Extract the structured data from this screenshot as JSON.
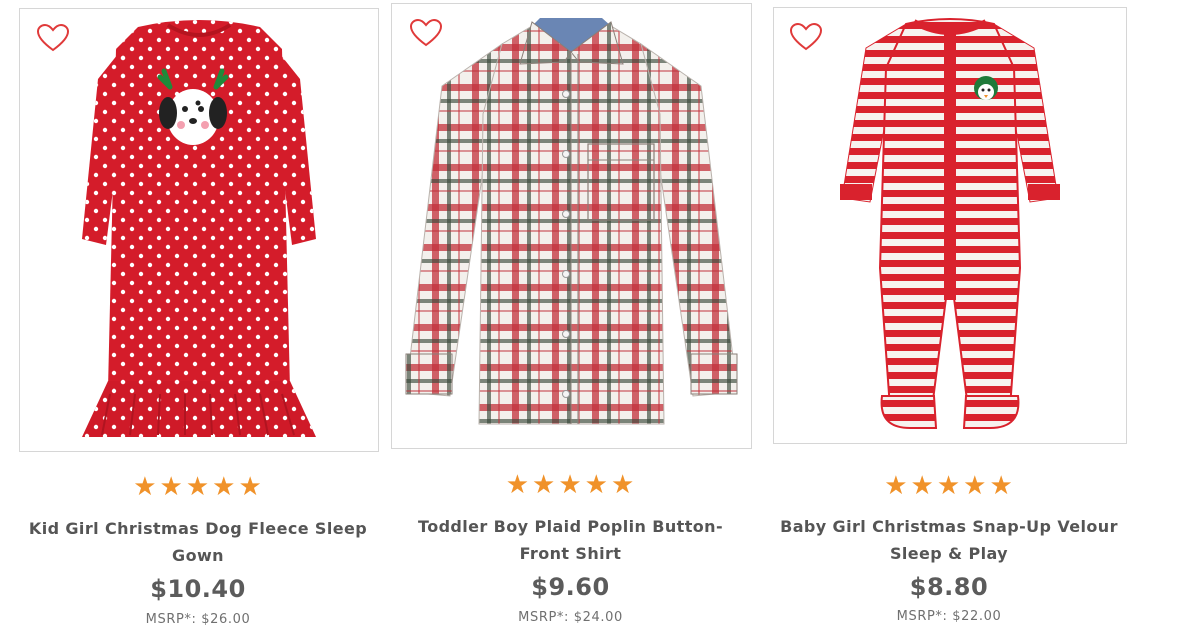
{
  "products": [
    {
      "title": "Kid Girl Christmas Dog Fleece Sleep Gown",
      "rating": 5,
      "price": "$10.40",
      "msrp": "MSRP*: $26.00",
      "image": "red polka-dot sleep gown with dog face"
    },
    {
      "title": "Toddler Boy Plaid Poplin Button-Front Shirt",
      "rating": 5,
      "price": "$9.60",
      "msrp": "MSRP*: $24.00",
      "image": "red and white plaid button-front shirt"
    },
    {
      "title": "Baby Girl Christmas Snap-Up Velour Sleep & Play",
      "rating": 5,
      "price": "$8.80",
      "msrp": "MSRP*: $22.00",
      "image": "red and white striped footed sleeper"
    }
  ],
  "icons": {
    "favorite": "heart-outline-icon",
    "rating": "star-icon"
  },
  "colors": {
    "heart": "#e03a3a",
    "star": "#f0922a",
    "text": "#555555",
    "border": "#d6d6d6"
  }
}
